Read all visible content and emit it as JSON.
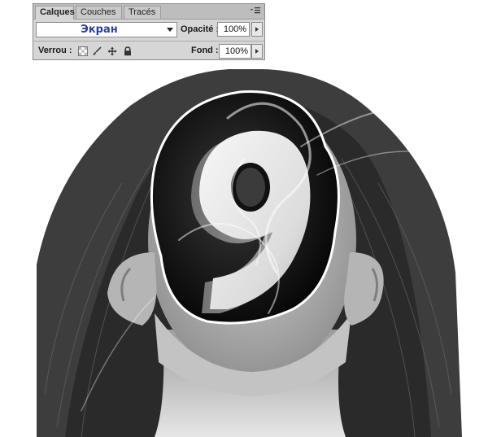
{
  "panel": {
    "tabs": [
      {
        "label": "Calques",
        "active": true
      },
      {
        "label": "Couches",
        "active": false
      },
      {
        "label": "Tracés",
        "active": false
      }
    ],
    "menu_icon": "panel-menu-icon",
    "blend_mode": {
      "value": "Экран",
      "color": "#2b3fa6"
    },
    "opacity": {
      "label": "Opacité :",
      "value": "100%"
    },
    "lock": {
      "label": "Verrou :",
      "icons": [
        "lock-transparency-icon",
        "lock-pixels-brush-icon",
        "lock-position-move-icon",
        "lock-all-padlock-icon"
      ]
    },
    "fill": {
      "label": "Fond :",
      "value": "100%"
    }
  },
  "artwork": {
    "description_icon": "layer-artwork-image"
  }
}
